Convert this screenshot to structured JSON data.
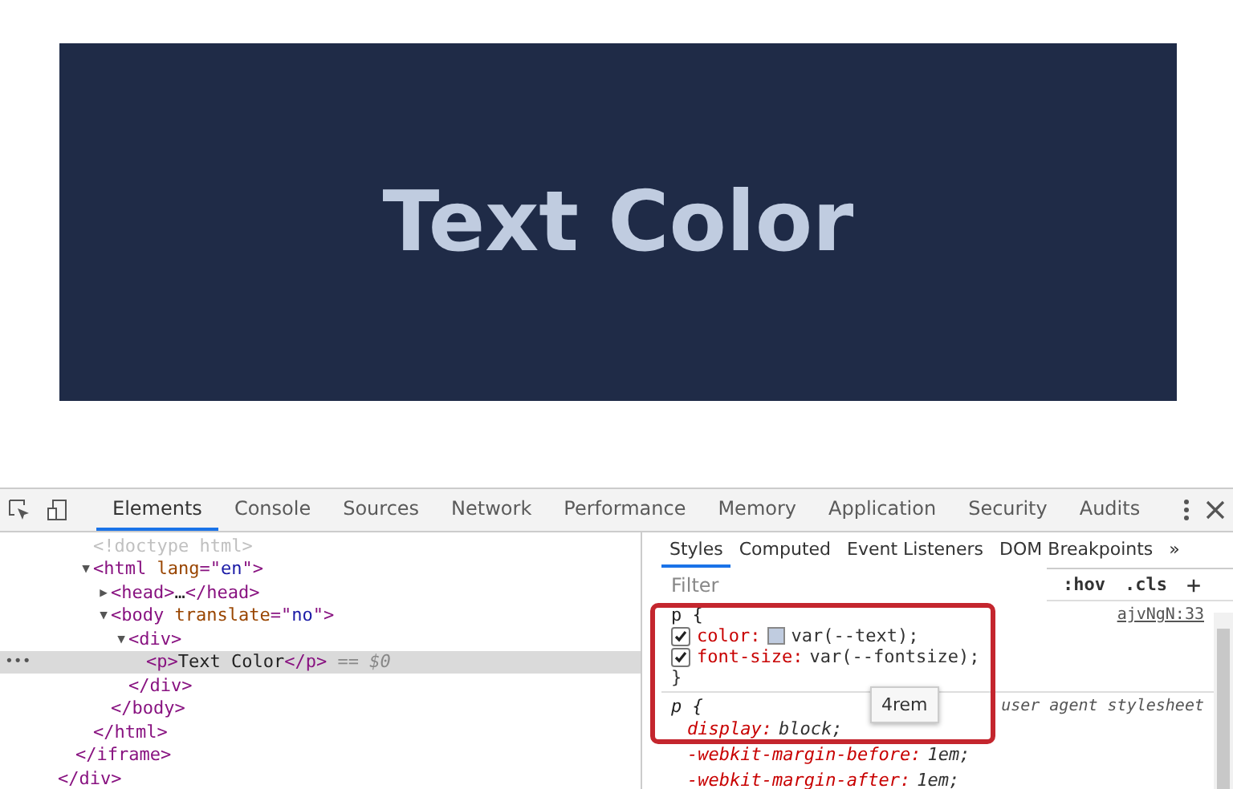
{
  "preview": {
    "text": "Text Color"
  },
  "devtools": {
    "tabs": [
      {
        "label": "Elements",
        "selected": true
      },
      {
        "label": "Console",
        "selected": false
      },
      {
        "label": "Sources",
        "selected": false
      },
      {
        "label": "Network",
        "selected": false
      },
      {
        "label": "Performance",
        "selected": false
      },
      {
        "label": "Memory",
        "selected": false
      },
      {
        "label": "Application",
        "selected": false
      },
      {
        "label": "Security",
        "selected": false
      },
      {
        "label": "Audits",
        "selected": false
      }
    ],
    "dom_tree": [
      {
        "selected": false,
        "close": [
          {
            "kind": "tag",
            "t": "</div>"
          }
        ],
        "children": [
          {
            "selected": false,
            "close": [
              {
                "kind": "tag",
                "t": "</iframe>"
              }
            ],
            "children": [
              {
                "selected": false,
                "open": [
                  {
                    "kind": "doctype",
                    "t": "<!doctype html>"
                  }
                ]
              },
              {
                "toggle": "▼",
                "selected": false,
                "open": [
                  {
                    "kind": "tag",
                    "t": "<html"
                  },
                  {
                    "kind": "attr",
                    "t": " lang"
                  },
                  {
                    "kind": "tag",
                    "t": "=\""
                  },
                  {
                    "kind": "value",
                    "t": "en"
                  },
                  {
                    "kind": "tag",
                    "t": "\">"
                  }
                ],
                "close": [
                  {
                    "kind": "tag",
                    "t": "</html>"
                  }
                ],
                "children": [
                  {
                    "toggle": "▶",
                    "selected": false,
                    "open": [
                      {
                        "kind": "tag",
                        "t": "<head>"
                      },
                      {
                        "kind": "text",
                        "t": "…"
                      },
                      {
                        "kind": "tag",
                        "t": "</head>"
                      }
                    ]
                  },
                  {
                    "toggle": "▼",
                    "selected": false,
                    "open": [
                      {
                        "kind": "tag",
                        "t": "<body"
                      },
                      {
                        "kind": "attr",
                        "t": " translate"
                      },
                      {
                        "kind": "tag",
                        "t": "=\""
                      },
                      {
                        "kind": "value",
                        "t": "no"
                      },
                      {
                        "kind": "tag",
                        "t": "\">"
                      }
                    ],
                    "close": [
                      {
                        "kind": "tag",
                        "t": "</body>"
                      }
                    ],
                    "children": [
                      {
                        "toggle": "▼",
                        "selected": false,
                        "open": [
                          {
                            "kind": "tag",
                            "t": "<div>"
                          }
                        ],
                        "close": [
                          {
                            "kind": "tag",
                            "t": "</div>"
                          }
                        ],
                        "children": [
                          {
                            "selected": true,
                            "marker": "•••",
                            "open": [
                              {
                                "kind": "tag",
                                "t": "<p>"
                              },
                              {
                                "kind": "text",
                                "t": "Text Color"
                              },
                              {
                                "kind": "tag",
                                "t": "</p>"
                              },
                              {
                                "kind": "ref",
                                "t": " == $0"
                              }
                            ]
                          }
                        ]
                      }
                    ]
                  }
                ]
              }
            ]
          }
        ]
      }
    ],
    "styles": {
      "subtabs": [
        {
          "label": "Styles",
          "selected": true
        },
        {
          "label": "Computed",
          "selected": false
        },
        {
          "label": "Event Listeners",
          "selected": false
        },
        {
          "label": "DOM Breakpoints",
          "selected": false
        },
        {
          "label": "»",
          "selected": false
        }
      ],
      "filter": {
        "placeholder": "Filter"
      },
      "hov": ":hov",
      "cls": ".cls",
      "add": "+",
      "rules": [
        {
          "kind": "author",
          "selector": "p {",
          "source": "ajvNgN:33",
          "close": "}",
          "declarations": [
            {
              "checked": true,
              "property": "color:",
              "value": "var(--text);",
              "color": "#c0cce0"
            },
            {
              "checked": true,
              "property": "font-size:",
              "value": "var(--fontsize);"
            }
          ]
        },
        {
          "kind": "agent",
          "selector": "p {",
          "source": "user agent stylesheet",
          "declarations": [
            {
              "property": "display:",
              "value": "block;"
            },
            {
              "property": "-webkit-margin-before:",
              "value": "1em;"
            },
            {
              "property": "-webkit-margin-after:",
              "value": "1em;"
            }
          ]
        }
      ],
      "tooltip": "4rem"
    }
  }
}
